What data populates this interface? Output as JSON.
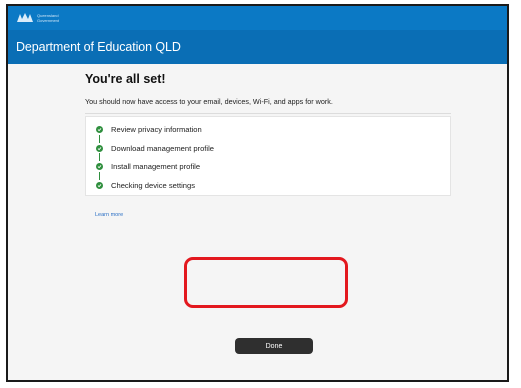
{
  "branding": {
    "logo_line1": "Queensland",
    "logo_line2": "Government"
  },
  "header": {
    "title": "Department of Education QLD"
  },
  "main": {
    "heading": "You're all set!",
    "subtext": "You should now have access to your email, devices, Wi-Fi, and apps for work.",
    "steps": [
      {
        "label": "Review privacy information",
        "icon": "check-circle-icon"
      },
      {
        "label": "Download management profile",
        "icon": "check-circle-icon"
      },
      {
        "label": "Install management profile",
        "icon": "check-circle-icon"
      },
      {
        "label": "Checking device settings",
        "icon": "check-circle-icon"
      }
    ],
    "learn_more": "Learn more",
    "done_label": "Done"
  },
  "colors": {
    "topbar": "#0b79c5",
    "header": "#0a6eb5",
    "success": "#2f8f3e",
    "button": "#2f2f2f",
    "highlight": "#e3181e",
    "link": "#2a6fc5"
  }
}
